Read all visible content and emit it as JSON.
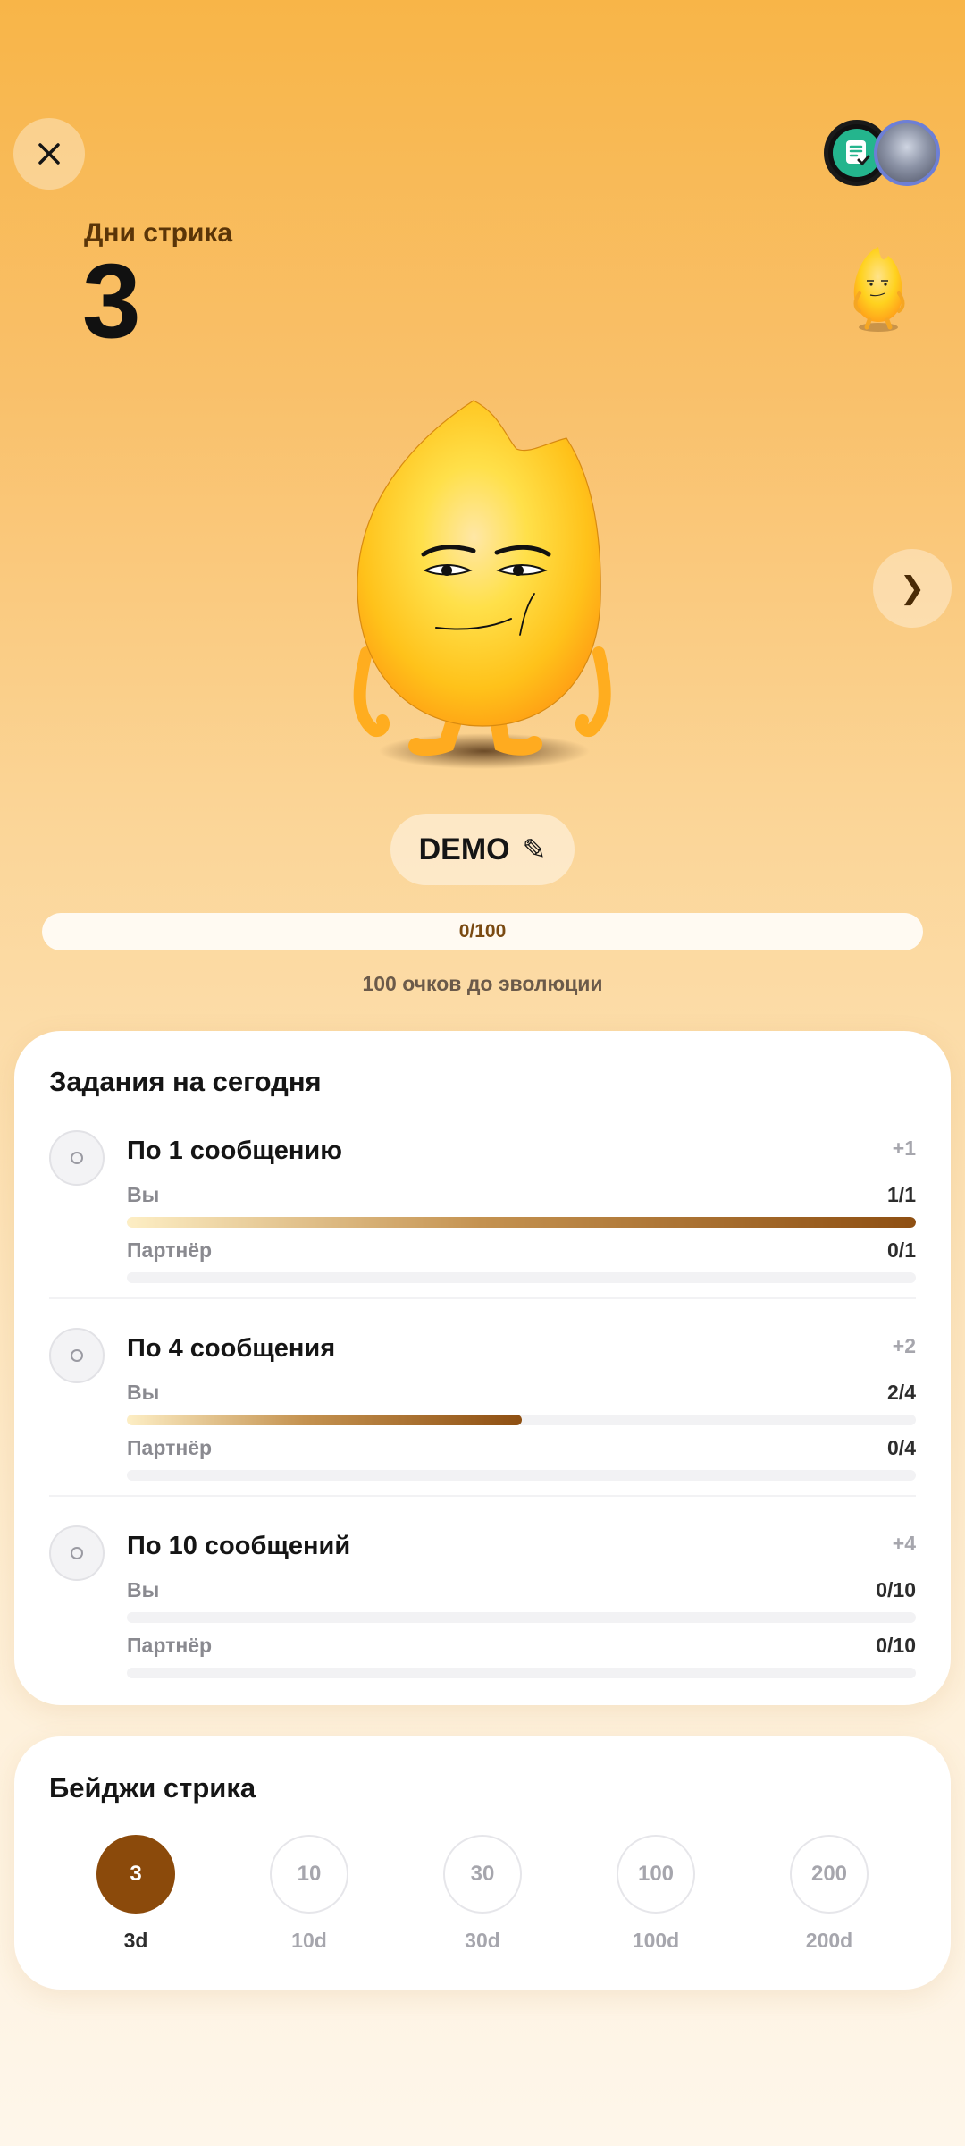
{
  "header": {
    "streak_label": "Дни стрика",
    "streak_count": "3"
  },
  "pet": {
    "name": "DEMO",
    "edit_icon": "✎",
    "next_icon": "❯",
    "xp_progress": "0/100",
    "xp_fraction": 0,
    "evolution_hint": "100 очков до эволюции"
  },
  "tasks": {
    "title": "Задания на сегодня",
    "you_label": "Вы",
    "partner_label": "Партнёр",
    "items": [
      {
        "title": "По 1 сообщению",
        "points": "+1",
        "you_value": "1/1",
        "you_fraction": 1.0,
        "partner_value": "0/1",
        "partner_fraction": 0
      },
      {
        "title": "По 4 сообщения",
        "points": "+2",
        "you_value": "2/4",
        "you_fraction": 0.5,
        "partner_value": "0/4",
        "partner_fraction": 0
      },
      {
        "title": "По 10 сообщений",
        "points": "+4",
        "you_value": "0/10",
        "you_fraction": 0,
        "partner_value": "0/10",
        "partner_fraction": 0
      }
    ]
  },
  "badges": {
    "title": "Бейджи стрика",
    "items": [
      {
        "value": "3",
        "label": "3d",
        "achieved": true
      },
      {
        "value": "10",
        "label": "10d",
        "achieved": false
      },
      {
        "value": "30",
        "label": "30d",
        "achieved": false
      },
      {
        "value": "100",
        "label": "100d",
        "achieved": false
      },
      {
        "value": "200",
        "label": "200d",
        "achieved": false
      }
    ]
  },
  "icons": {
    "close": "close-icon",
    "next": "chevron-right-icon",
    "edit": "pencil-icon",
    "task_check": "circle-check-icon"
  },
  "colors": {
    "accent": "#8b4a0b",
    "background_top": "#f8b548",
    "avatar_green": "#24b58d"
  }
}
